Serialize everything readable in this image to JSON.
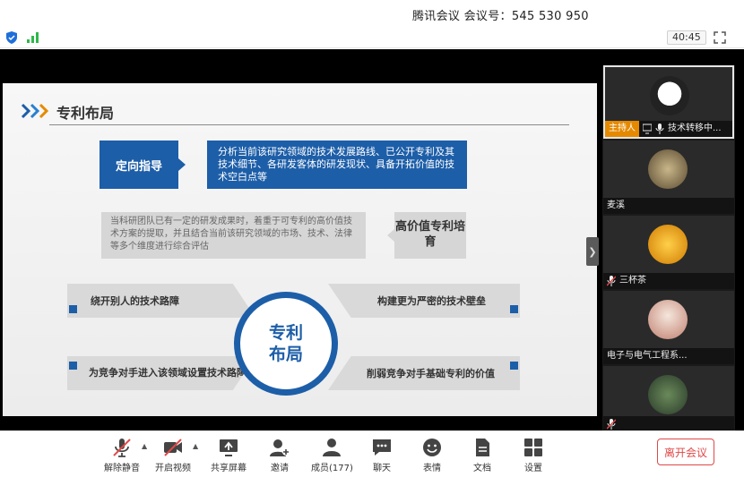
{
  "window": {
    "title": "腾讯会议 会议号：545 530 950"
  },
  "status": {
    "timer": "40:45"
  },
  "slide": {
    "title": "专利布局",
    "direction_label": "定向指导",
    "direction_desc": "分析当前该研究领域的技术发展路线、已公开专利及其技术细节、各研发客体的研发现状、具备开拓价值的技术空白点等",
    "team_desc": "当科研团队已有一定的研发成果时，着重于可专利的高价值技术方案的提取，并且结合当前该研究领域的市场、技术、法律等多个维度进行综合评估",
    "high_value_label": "高价值专利培育",
    "center_label": "专利布局",
    "points": [
      "绕开别人的技术路障",
      "为竞争对手进入该领域设置技术路障",
      "构建更为严密的技术壁垒",
      "削弱竞争对手基础专利的价值"
    ]
  },
  "participants": [
    {
      "name": "技术转移中...",
      "host_badge": "主持人",
      "avatar_color": "#f2f2f2"
    },
    {
      "name": "麦溪",
      "avatar_color": "#8a7a5a"
    },
    {
      "name": "三杯茶",
      "avatar_color": "#e9a21a"
    },
    {
      "name": "电子与电气工程系...",
      "avatar_color": "#e6d2c6"
    },
    {
      "name": "",
      "avatar_color": "#3e5a3a"
    }
  ],
  "toolbar": {
    "unmute": "解除静音",
    "start_video": "开启视频",
    "share_screen": "共享屏幕",
    "invite": "邀请",
    "members": "成员(177)",
    "chat": "聊天",
    "reactions": "表情",
    "docs": "文档",
    "settings": "设置",
    "leave": "离开会议"
  },
  "colors": {
    "accent": "#1d5ea8",
    "leave": "#e04848",
    "host_badge": "#e58a00"
  }
}
